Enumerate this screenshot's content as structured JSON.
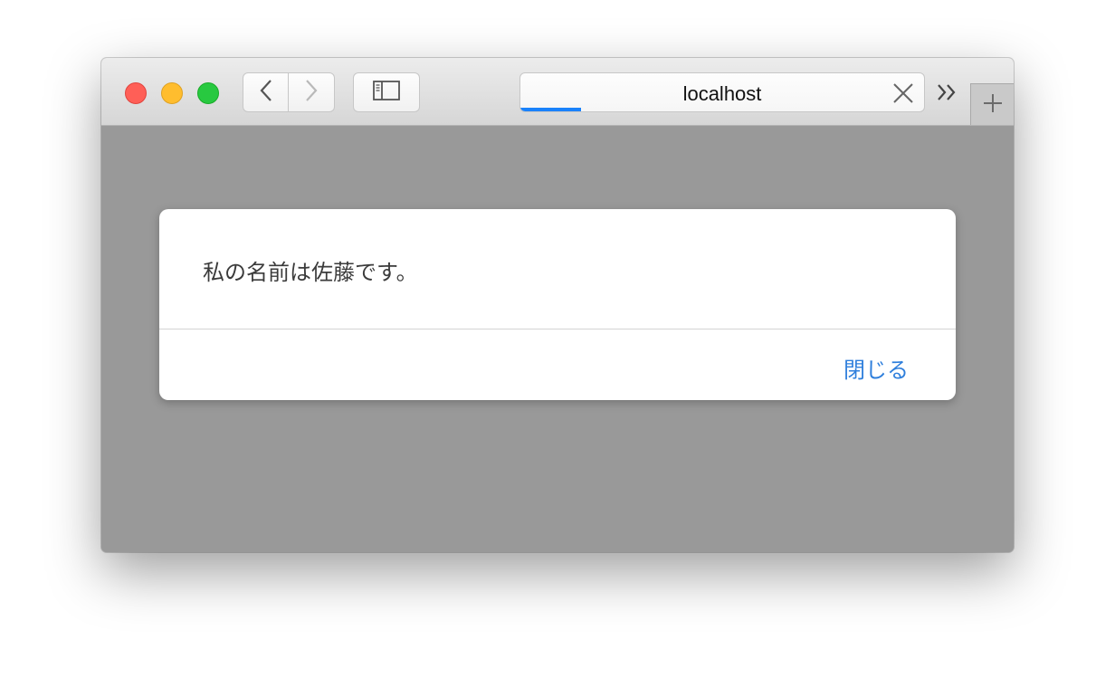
{
  "window": {
    "traffic_lights": [
      "close",
      "minimize",
      "maximize"
    ]
  },
  "toolbar": {
    "back_icon": "chevron-left-icon",
    "forward_icon": "chevron-right-icon",
    "sidebar_icon": "sidebar-icon"
  },
  "tab": {
    "title": "localhost",
    "loading_progress": 0.15,
    "close_icon": "close-icon"
  },
  "tabbar": {
    "overflow_icon": "double-chevron-right-icon",
    "new_tab_icon": "plus-icon"
  },
  "dialog": {
    "message": "私の名前は佐藤です。",
    "close_label": "閉じる"
  },
  "colors": {
    "accent": "#2f7fdc",
    "progress": "#1a82fb",
    "overlay": "#999999"
  }
}
